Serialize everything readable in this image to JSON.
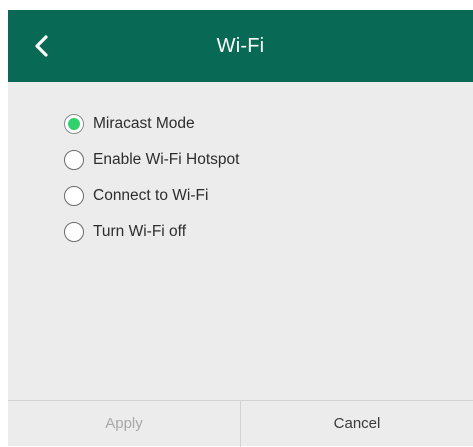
{
  "header": {
    "title": "Wi-Fi",
    "back_icon": "chevron-left-icon",
    "background_color": "#086a55"
  },
  "options": [
    {
      "label": "Miracast Mode",
      "selected": true
    },
    {
      "label": "Enable Wi-Fi Hotspot",
      "selected": false
    },
    {
      "label": "Connect to Wi-Fi",
      "selected": false
    },
    {
      "label": "Turn Wi-Fi off",
      "selected": false
    }
  ],
  "selected_color": "#2fd26a",
  "footer": {
    "apply_label": "Apply",
    "apply_enabled": false,
    "cancel_label": "Cancel"
  }
}
